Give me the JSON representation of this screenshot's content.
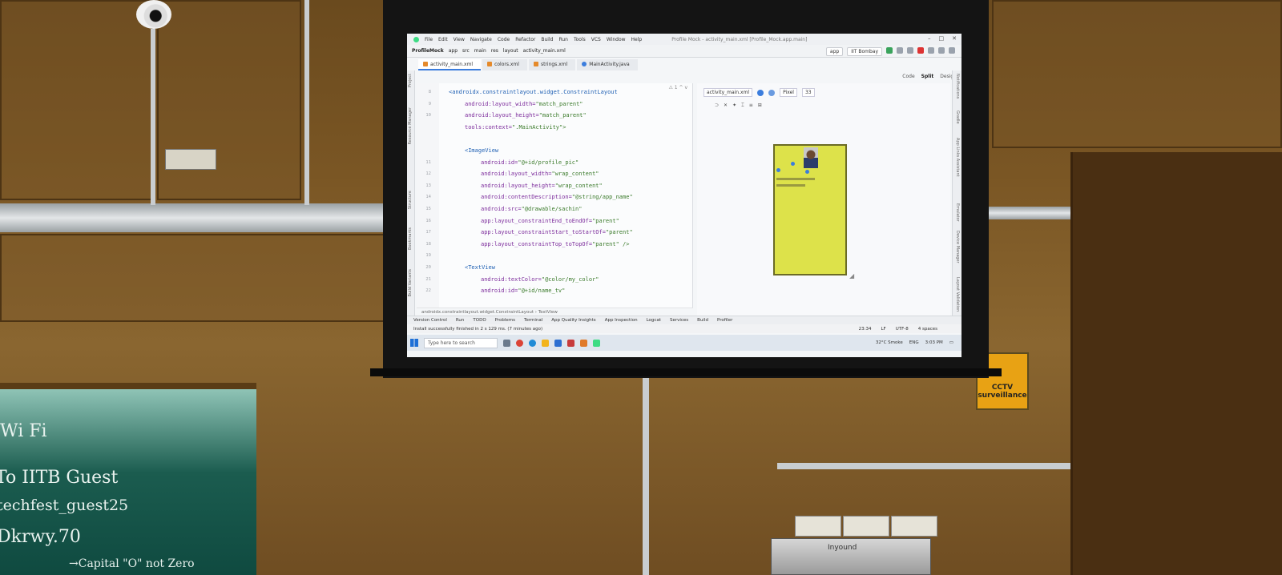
{
  "ide": {
    "menu": [
      "File",
      "Edit",
      "View",
      "Navigate",
      "Code",
      "Refactor",
      "Build",
      "Run",
      "Tools",
      "VCS",
      "Window",
      "Help"
    ],
    "window_title": "Profile Mock - activity_main.xml [Profile_Mock.app.main]",
    "breadcrumb": [
      "ProfileMock",
      "app",
      "src",
      "main",
      "res",
      "layout",
      "activity_main.xml"
    ],
    "run_config": "app",
    "device": "IIT Bombay",
    "tabs": [
      {
        "label": "activity_main.xml",
        "type": "xml",
        "active": true
      },
      {
        "label": "colors.xml",
        "type": "xml",
        "active": false
      },
      {
        "label": "strings.xml",
        "type": "xml",
        "active": false
      },
      {
        "label": "MainActivity.java",
        "type": "java",
        "active": false
      }
    ],
    "view_modes": [
      "Code",
      "Split",
      "Design"
    ],
    "left_tools": [
      "Project",
      "Resource Manager",
      "Structure",
      "Bookmarks",
      "Build Variants"
    ],
    "right_tools": [
      "Notifications",
      "Gradle",
      "App Links Assistant",
      "Emulator",
      "Device Manager",
      "Layout Validation"
    ],
    "code_lines": [
      {
        "num": "8",
        "indent": 0,
        "parts": [
          [
            "tag",
            "<androidx.constraintlayout.widget.ConstraintLayout"
          ]
        ]
      },
      {
        "num": "9",
        "indent": 1,
        "parts": [
          [
            "attr",
            "android:layout_width="
          ],
          [
            "val",
            "\"match_parent\""
          ]
        ]
      },
      {
        "num": "10",
        "indent": 1,
        "parts": [
          [
            "attr",
            "android:layout_height="
          ],
          [
            "val",
            "\"match_parent\""
          ]
        ]
      },
      {
        "num": "",
        "indent": 1,
        "parts": [
          [
            "attr",
            "tools:context="
          ],
          [
            "val",
            "\".MainActivity\">"
          ]
        ]
      },
      {
        "num": "",
        "indent": 0,
        "parts": []
      },
      {
        "num": "",
        "indent": 1,
        "parts": [
          [
            "tag",
            "<ImageView"
          ]
        ]
      },
      {
        "num": "11",
        "indent": 2,
        "parts": [
          [
            "attr",
            "android:id="
          ],
          [
            "val",
            "\"@+id/profile_pic\""
          ]
        ]
      },
      {
        "num": "12",
        "indent": 2,
        "parts": [
          [
            "attr",
            "android:layout_width="
          ],
          [
            "val",
            "\"wrap_content\""
          ]
        ]
      },
      {
        "num": "13",
        "indent": 2,
        "parts": [
          [
            "attr",
            "android:layout_height="
          ],
          [
            "val",
            "\"wrap_content\""
          ]
        ]
      },
      {
        "num": "14",
        "indent": 2,
        "parts": [
          [
            "attr",
            "android:contentDescription="
          ],
          [
            "val",
            "\"@string/app_name\""
          ]
        ]
      },
      {
        "num": "15",
        "indent": 2,
        "parts": [
          [
            "attr",
            "android:src="
          ],
          [
            "val",
            "\"@drawable/sachin\""
          ]
        ]
      },
      {
        "num": "16",
        "indent": 2,
        "parts": [
          [
            "attr",
            "app:layout_constraintEnd_toEndOf="
          ],
          [
            "val",
            "\"parent\""
          ]
        ]
      },
      {
        "num": "17",
        "indent": 2,
        "parts": [
          [
            "attr",
            "app:layout_constraintStart_toStartOf="
          ],
          [
            "val",
            "\"parent\""
          ]
        ]
      },
      {
        "num": "18",
        "indent": 2,
        "parts": [
          [
            "attr",
            "app:layout_constraintTop_toTopOf="
          ],
          [
            "val",
            "\"parent\" />"
          ]
        ]
      },
      {
        "num": "19",
        "indent": 0,
        "parts": []
      },
      {
        "num": "20",
        "indent": 1,
        "parts": [
          [
            "tag",
            "<TextView"
          ]
        ]
      },
      {
        "num": "21",
        "indent": 2,
        "parts": [
          [
            "attr",
            "android:textColor="
          ],
          [
            "val",
            "\"@color/my_color\""
          ]
        ]
      },
      {
        "num": "22",
        "indent": 2,
        "parts": [
          [
            "attr",
            "android:id="
          ],
          [
            "val",
            "\"@+id/name_tv\""
          ]
        ]
      }
    ],
    "editor_path": "androidx.constraintlayout.widget.ConstraintLayout  ›  TextView",
    "design_file": "activity_main.xml",
    "design_device": "Pixel",
    "design_api": "33",
    "bottom_tools": [
      "Version Control",
      "Run",
      "TODO",
      "Problems",
      "Terminal",
      "App Quality Insights",
      "App Inspection",
      "Logcat",
      "Services",
      "Build",
      "Profiler"
    ],
    "status_message": "Install successfully finished in 2 s 129 ms. (7 minutes ago)",
    "status_right": [
      "23:34",
      "LF",
      "UTF-8",
      "4 spaces"
    ],
    "taskbar_search": "Type here to search",
    "tray": [
      "32°C Smoke",
      "ENG",
      "3:03 PM"
    ],
    "colors": {
      "yellow_preview": "#dde24a",
      "accent": "#3b7ddd"
    }
  },
  "room": {
    "board_lines": [
      "Wi Fi",
      "To IITB Guest",
      "techfest_guest25",
      "Dkrwy.70",
      "→Capital \"O\" not Zero"
    ],
    "sign_text": "CCTV surveillance",
    "projector_brand": "Inyound"
  }
}
